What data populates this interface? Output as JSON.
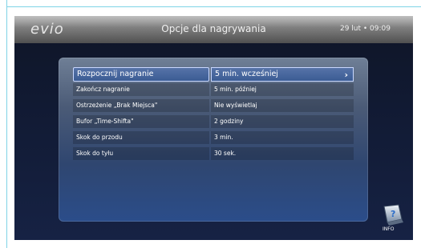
{
  "header": {
    "logo": "evio",
    "title": "Opcje dla nagrywania",
    "datetime": "29 lut • 09:09"
  },
  "options": [
    {
      "label": "Rozpocznij nagranie",
      "value": "5 min. wcześniej"
    },
    {
      "label": "Zakończ nagranie",
      "value": "5 min. później"
    },
    {
      "label": "Ostrzeżenie „Brak Miejsca\"",
      "value": "Nie wyświetlaj"
    },
    {
      "label": "Bufor „Time-Shifta\"",
      "value": "2 godziny"
    },
    {
      "label": "Skok do przodu",
      "value": "3 min."
    },
    {
      "label": "Skok do tyłu",
      "value": "30 sek."
    }
  ],
  "selected_index": 0,
  "info_button": {
    "label": "INFO"
  },
  "icons": {
    "next": "chevron-right-icon",
    "info": "info-icon"
  }
}
